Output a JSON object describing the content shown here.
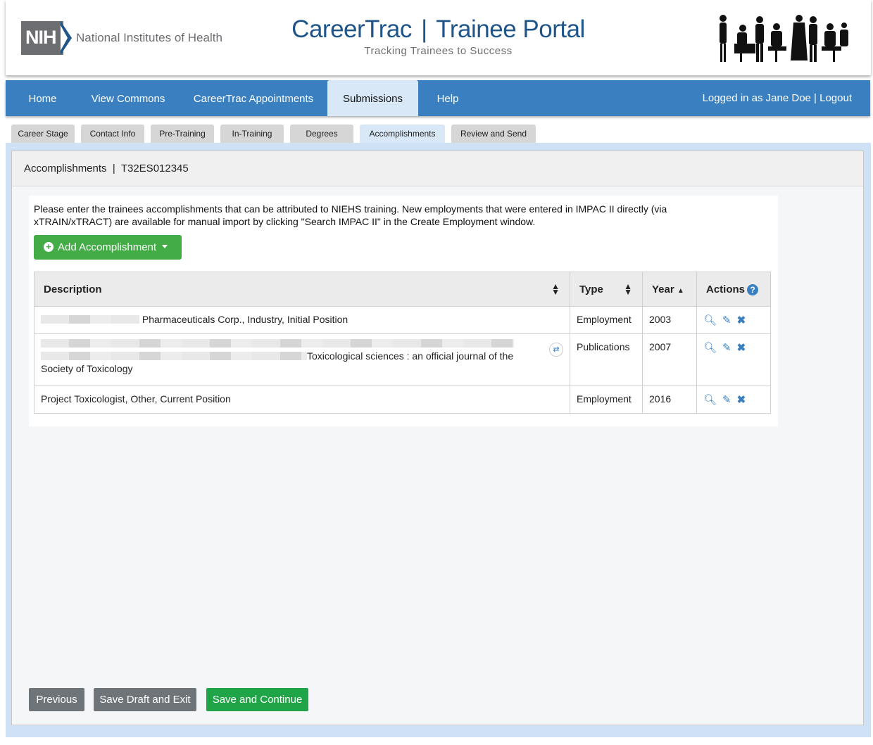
{
  "header": {
    "org_abbr": "NIH",
    "org_name": "National Institutes of Health",
    "title_left": "CareerTrac",
    "title_sep": "|",
    "title_right": "Trainee Portal",
    "subtitle": "Tracking Trainees to Success"
  },
  "nav": {
    "items": [
      "Home",
      "View Commons",
      "CareerTrac Appointments",
      "Submissions",
      "Help"
    ],
    "active": "Submissions",
    "login_text": "Logged in as Jane Doe | Logout"
  },
  "subtabs": {
    "items": [
      "Career Stage",
      "Contact Info",
      "Pre-Training",
      "In-Training",
      "Degrees",
      "Accomplishments",
      "Review and Send"
    ],
    "active": "Accomplishments"
  },
  "panel": {
    "heading": "Accomplishments  |  T32ES012345",
    "intro": "Please enter the trainees accomplishments that can be attributed to NIEHS training. New employments that were entered in IMPAC II directly (via xTRAIN/xTRACT) are available for manual import by clicking \"Search IMPAC II\" in the Create Employment window.",
    "add_button": "Add Accomplishment"
  },
  "table": {
    "columns": [
      "Description",
      "Type",
      "Year",
      "Actions"
    ],
    "rows": [
      {
        "description": "Pharmaceuticals Corp., Industry, Initial Position",
        "type": "Employment",
        "year": "2003"
      },
      {
        "description_line2": "Toxicological sciences : an official journal of the",
        "description_line3": "Society of Toxicology",
        "type": "Publications",
        "year": "2007"
      },
      {
        "description": "Project Toxicologist, Other, Current Position",
        "type": "Employment",
        "year": "2016"
      }
    ]
  },
  "footer": {
    "previous": "Previous",
    "save_draft": "Save Draft and Exit",
    "save_continue": "Save and Continue"
  },
  "icons": {
    "view": "magnifier-icon",
    "edit": "pencil-icon",
    "delete": "x-icon",
    "help": "question-circle-icon"
  },
  "colors": {
    "nav_blue": "#3a7fbf",
    "brand_blue": "#20558a",
    "green": "#43ac47",
    "button_gray": "#6f7479"
  }
}
